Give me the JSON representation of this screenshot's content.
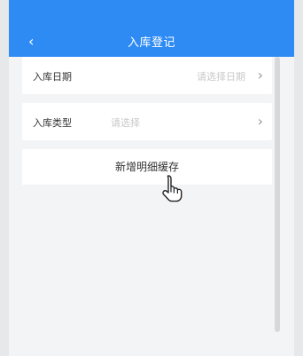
{
  "header": {
    "title": "入库登记",
    "back_icon": "chevron-left-icon"
  },
  "form": {
    "date_label": "入库日期",
    "date_placeholder": "请选择日期",
    "type_label": "入库类型",
    "type_placeholder": "请选择"
  },
  "actions": {
    "add_detail_cache": "新增明细缓存"
  },
  "icons": {
    "chevron": "chevron-right-icon",
    "cursor": "hand-pointer-icon"
  },
  "colors": {
    "primary": "#2e8bf4",
    "background": "#f3f4f6"
  }
}
